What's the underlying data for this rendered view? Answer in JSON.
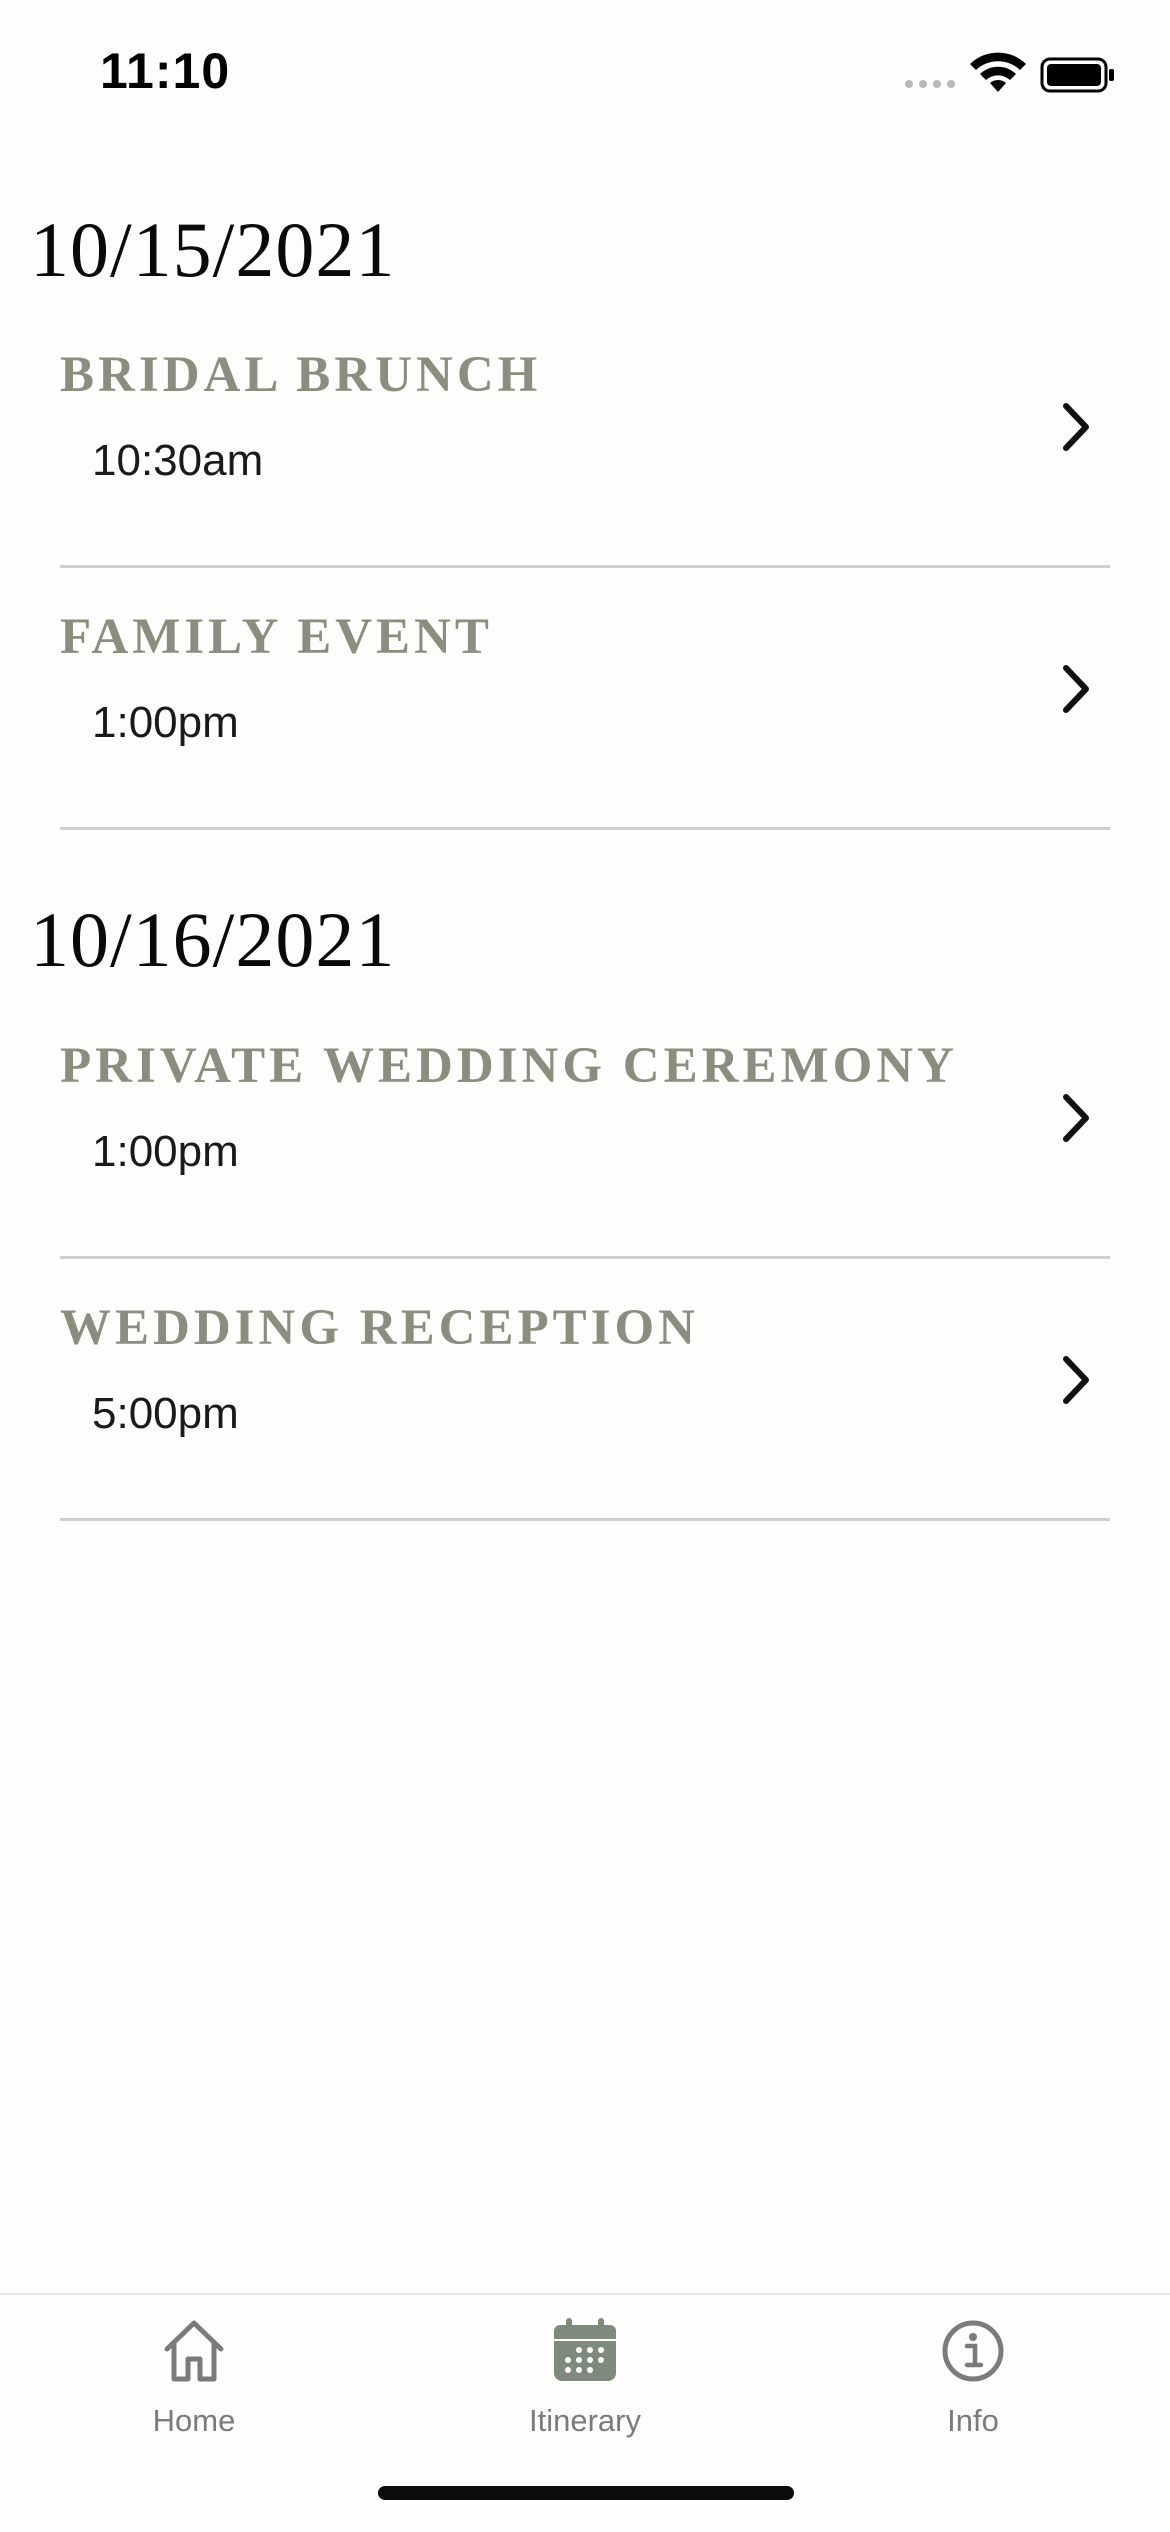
{
  "status_bar": {
    "time": "11:10",
    "icons": [
      "cellular-signal-icon",
      "wifi-icon",
      "battery-icon"
    ]
  },
  "days": [
    {
      "date": "10/15/2021",
      "events": [
        {
          "title": "BRIDAL BRUNCH",
          "time": "10:30am"
        },
        {
          "title": "FAMILY EVENT",
          "time": "1:00pm"
        }
      ]
    },
    {
      "date": "10/16/2021",
      "events": [
        {
          "title": "PRIVATE WEDDING CEREMONY",
          "time": "1:00pm"
        },
        {
          "title": "WEDDING RECEPTION",
          "time": "5:00pm"
        }
      ]
    }
  ],
  "tab_bar": {
    "tabs": [
      {
        "label": "Home",
        "icon": "house-icon",
        "selected": false
      },
      {
        "label": "Itinerary",
        "icon": "calendar-icon",
        "selected": true
      },
      {
        "label": "Info",
        "icon": "info-icon",
        "selected": false
      }
    ]
  },
  "colors": {
    "background": "#fefdfb",
    "event_title": "#8c8d7f",
    "accent": "#7e8a7b",
    "divider": "#cfcfcf",
    "tab_inactive": "#7b7b7b"
  }
}
